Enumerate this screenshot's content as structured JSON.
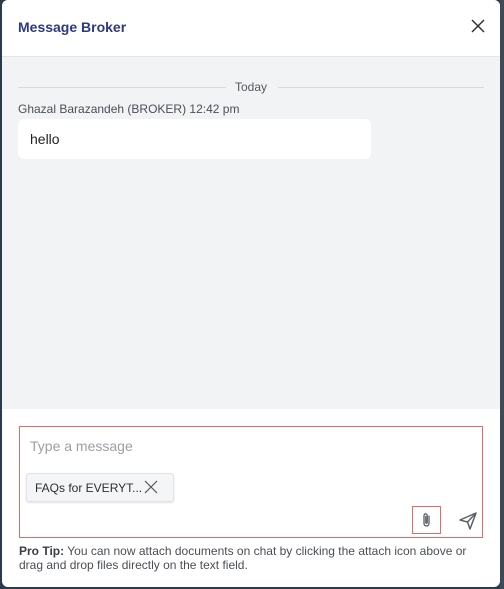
{
  "header": {
    "title": "Message Broker"
  },
  "chat": {
    "date_divider": "Today",
    "messages": [
      {
        "sender": "Ghazal Barazandeh (BROKER)",
        "time": "12:42 pm",
        "text": "hello"
      }
    ]
  },
  "composer": {
    "placeholder": "Type a message",
    "attachment": {
      "name": "FAQs for EVERYT..."
    }
  },
  "pro_tip": {
    "label": "Pro Tip:",
    "text": " You can now attach documents on chat by clicking the attach icon above or drag and drop files directly on the text field."
  },
  "colors": {
    "title": "#2e3a7d",
    "highlight_border": "#e06b6b",
    "chat_background": "#f2f3f5"
  },
  "icons": {
    "close": "close-icon",
    "chip_remove": "close-icon",
    "attach": "paperclip-icon",
    "send": "send-icon"
  }
}
